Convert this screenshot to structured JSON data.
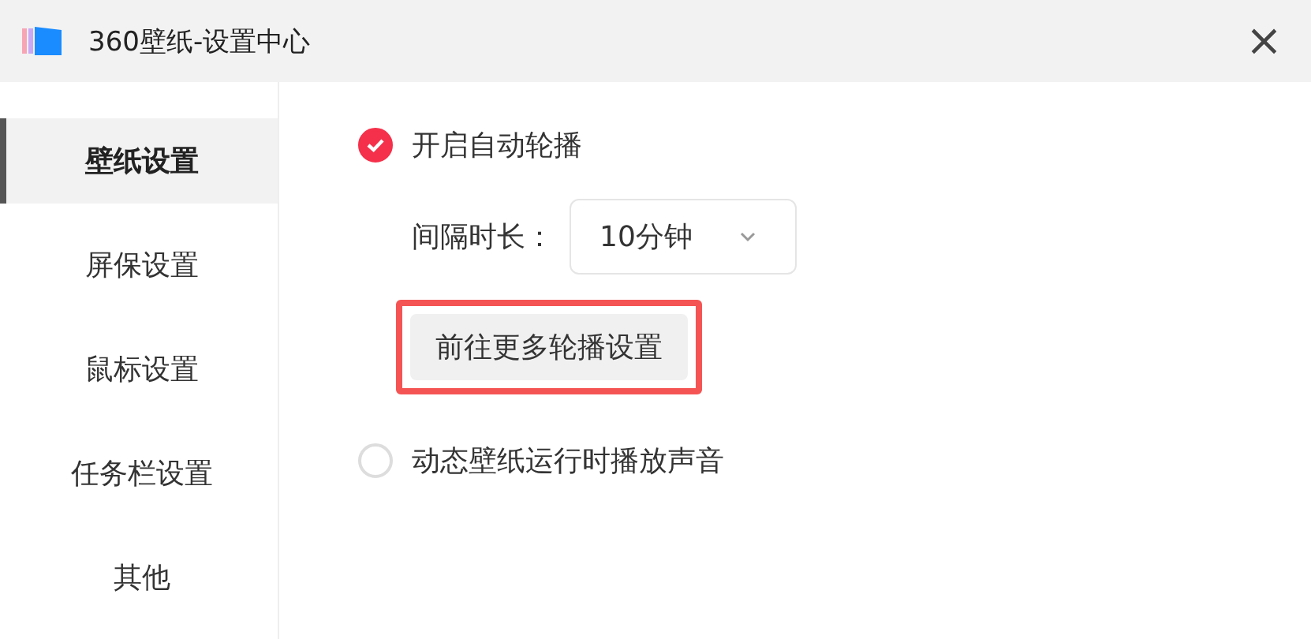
{
  "window": {
    "title": "360壁纸-设置中心",
    "close": "×"
  },
  "sidebar": {
    "items": [
      {
        "label": "壁纸设置",
        "selected": true
      },
      {
        "label": "屏保设置",
        "selected": false
      },
      {
        "label": "鼠标设置",
        "selected": false
      },
      {
        "label": "任务栏设置",
        "selected": false
      },
      {
        "label": "其他",
        "selected": false
      }
    ]
  },
  "settings": {
    "auto_rotate": {
      "label": "开启自动轮播",
      "checked": true
    },
    "interval": {
      "label": "间隔时长：",
      "value": "10分钟"
    },
    "more_button": {
      "label": "前往更多轮播设置",
      "highlighted": true
    },
    "sound": {
      "label": "动态壁纸运行时播放声音",
      "checked": false
    }
  }
}
